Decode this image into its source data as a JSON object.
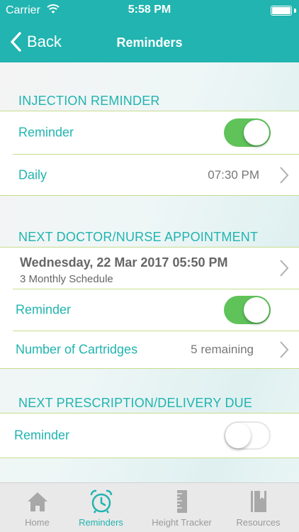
{
  "status_bar": {
    "carrier": "Carrier",
    "time": "5:58 PM"
  },
  "nav": {
    "back_label": "Back",
    "title": "Reminders"
  },
  "injection": {
    "header": "INJECTION REMINDER",
    "reminder_label": "Reminder",
    "reminder_on": true,
    "frequency_label": "Daily",
    "time_value": "07:30 PM"
  },
  "appointment": {
    "header": "NEXT DOCTOR/NURSE APPOINTMENT",
    "date": "Wednesday, 22 Mar 2017 05:50 PM",
    "schedule": "3 Monthly Schedule",
    "reminder_label": "Reminder",
    "reminder_on": true,
    "cartridges_label": "Number of Cartridges",
    "cartridges_value": "5 remaining"
  },
  "prescription": {
    "header": "NEXT PRESCRIPTION/DELIVERY DUE",
    "reminder_label": "Reminder",
    "reminder_on": false
  },
  "tabs": [
    {
      "label": "Home",
      "icon": "home-icon",
      "active": false
    },
    {
      "label": "Reminders",
      "icon": "alarm-clock-icon",
      "active": true
    },
    {
      "label": "Height Tracker",
      "icon": "ruler-icon",
      "active": false
    },
    {
      "label": "Resources",
      "icon": "book-icon",
      "active": false
    }
  ],
  "colors": {
    "accent": "#21b4b0",
    "toggle_on": "#5fc35a",
    "divider": "#c6dd8e"
  }
}
